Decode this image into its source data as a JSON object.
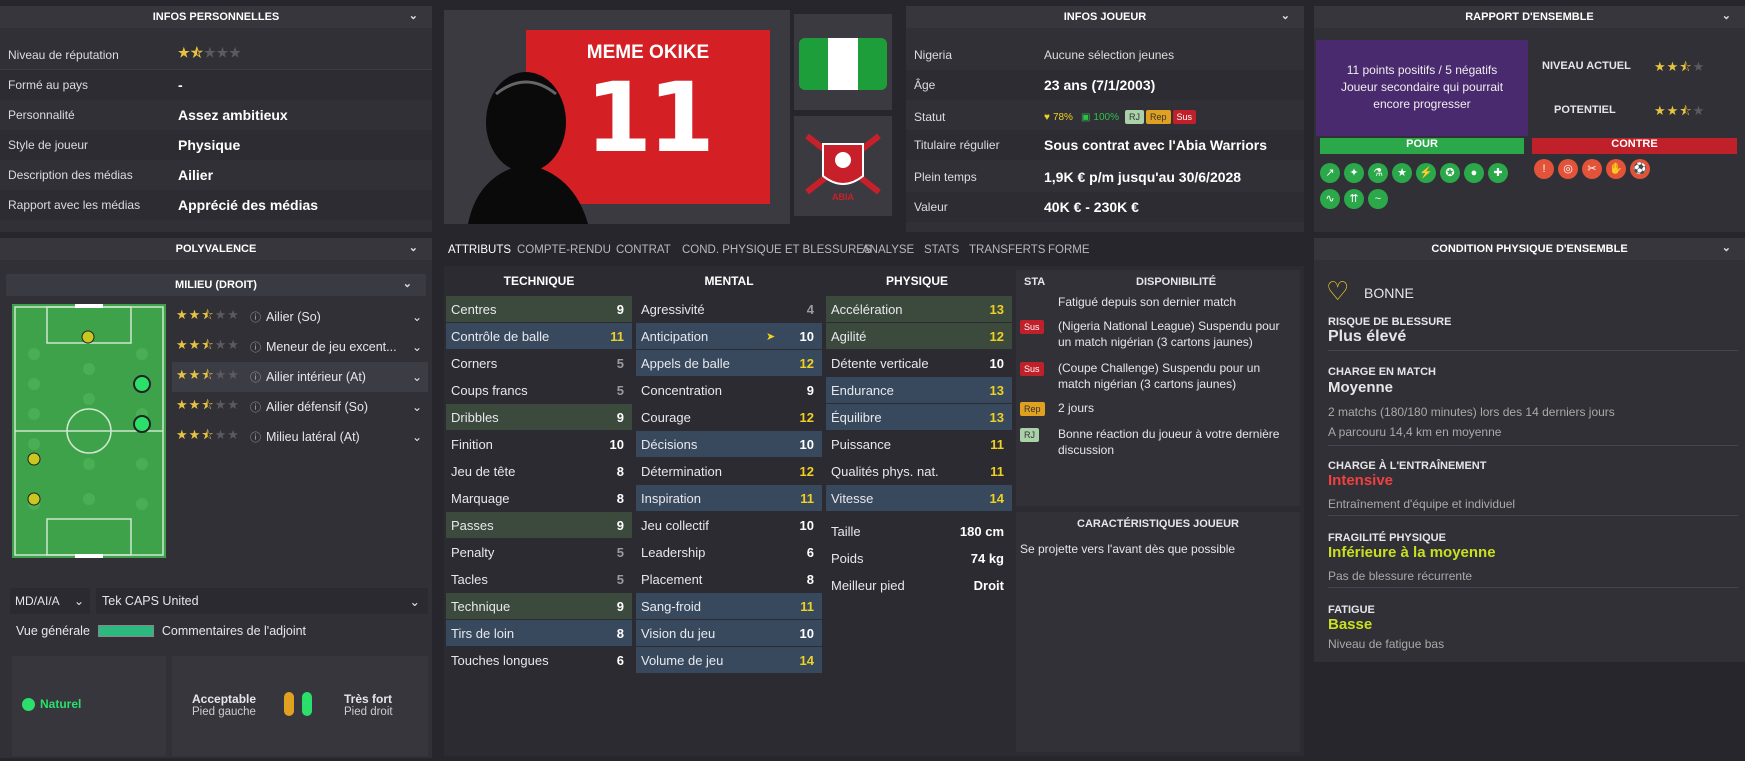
{
  "personal": {
    "title": "INFOS PERSONNELLES",
    "rows": [
      {
        "label": "Niveau de réputation",
        "value": ""
      },
      {
        "label": "Formé au pays",
        "value": "-"
      },
      {
        "label": "Personnalité",
        "value": "Assez ambitieux"
      },
      {
        "label": "Style de joueur",
        "value": "Physique"
      },
      {
        "label": "Description des médias",
        "value": "Ailier"
      },
      {
        "label": "Rapport avec les médias",
        "value": "Apprécié des médias"
      }
    ],
    "reputation_stars": 1.5
  },
  "player": {
    "name": "MEME OKIKE",
    "number": "11",
    "club_logo_text": "ABIA WARRIORS FC"
  },
  "info": {
    "title": "INFOS JOUEUR",
    "rows": [
      {
        "label": "Nigeria",
        "value": "Aucune sélection jeunes"
      },
      {
        "label": "Âge",
        "value": "23 ans (7/1/2003)"
      },
      {
        "label": "Statut",
        "value": ""
      },
      {
        "label": "Titulaire régulier",
        "value": "Sous contrat avec l'Abia Warriors"
      },
      {
        "label": "Plein temps",
        "value": "1,9K € p/m jusqu'au 30/6/2028"
      },
      {
        "label": "Valeur",
        "value": "40K € - 230K €"
      }
    ],
    "status": {
      "morale": "78%",
      "fitness": "100%",
      "badges": [
        "RJ",
        "Rep",
        "Sus"
      ]
    }
  },
  "report": {
    "title": "RAPPORT D'ENSEMBLE",
    "summary1": "11 points positifs / 5 négatifs",
    "summary2": "Joueur secondaire qui pourrait encore progresser",
    "current_label": "NIVEAU ACTUEL",
    "potential_label": "POTENTIEL",
    "current_stars": 2.5,
    "potential_stars": 2.5,
    "pour": "POUR",
    "contre": "CONTRE"
  },
  "poly": {
    "title": "POLYVALENCE",
    "position": "MILIEU (DROIT)",
    "roles": [
      {
        "name": "Ailier (So)",
        "stars": 2.5
      },
      {
        "name": "Meneur de jeu excent...",
        "stars": 2.5
      },
      {
        "name": "Ailier intérieur (At)",
        "stars": 2.5
      },
      {
        "name": "Ailier défensif (So)",
        "stars": 2.5
      },
      {
        "name": "Milieu latéral (At)",
        "stars": 2.5
      }
    ],
    "formation": "MD/AI/A",
    "team": "Tek CAPS United",
    "overview": "Vue générale",
    "assistant": "Commentaires de l'adjoint",
    "natural": "Naturel",
    "left_foot_val": "Acceptable",
    "left_foot": "Pied gauche",
    "right_foot_val": "Très fort",
    "right_foot": "Pied droit"
  },
  "tabs": [
    "ATTRIBUTS",
    "COMPTE-RENDU",
    "CONTRAT",
    "COND. PHYSIQUE ET BLESSURES",
    "ANALYSE",
    "STATS",
    "TRANSFERTS",
    "FORME"
  ],
  "attrs": {
    "tech_title": "TECHNIQUE",
    "mental_title": "MENTAL",
    "phys_title": "PHYSIQUE",
    "technique": [
      [
        "Centres",
        "9"
      ],
      [
        "Contrôle de balle",
        "11"
      ],
      [
        "Corners",
        "5"
      ],
      [
        "Coups francs",
        "5"
      ],
      [
        "Dribbles",
        "9"
      ],
      [
        "Finition",
        "10"
      ],
      [
        "Jeu de tête",
        "8"
      ],
      [
        "Marquage",
        "8"
      ],
      [
        "Passes",
        "9"
      ],
      [
        "Penalty",
        "5"
      ],
      [
        "Tacles",
        "5"
      ],
      [
        "Technique",
        "9"
      ],
      [
        "Tirs de loin",
        "8"
      ],
      [
        "Touches longues",
        "6"
      ]
    ],
    "mental": [
      [
        "Agressivité",
        "4"
      ],
      [
        "Anticipation",
        "10"
      ],
      [
        "Appels de balle",
        "12"
      ],
      [
        "Concentration",
        "9"
      ],
      [
        "Courage",
        "12"
      ],
      [
        "Décisions",
        "10"
      ],
      [
        "Détermination",
        "12"
      ],
      [
        "Inspiration",
        "11"
      ],
      [
        "Jeu collectif",
        "10"
      ],
      [
        "Leadership",
        "6"
      ],
      [
        "Placement",
        "8"
      ],
      [
        "Sang-froid",
        "11"
      ],
      [
        "Vision du jeu",
        "10"
      ],
      [
        "Volume de jeu",
        "14"
      ]
    ],
    "physique": [
      [
        "Accélération",
        "13"
      ],
      [
        "Agilité",
        "12"
      ],
      [
        "Détente verticale",
        "10"
      ],
      [
        "Endurance",
        "13"
      ],
      [
        "Équilibre",
        "13"
      ],
      [
        "Puissance",
        "11"
      ],
      [
        "Qualités phys. nat.",
        "11"
      ],
      [
        "Vitesse",
        "14"
      ]
    ],
    "body": [
      [
        "Taille",
        "180 cm"
      ],
      [
        "Poids",
        "74 kg"
      ],
      [
        "Meilleur pied",
        "Droit"
      ]
    ]
  },
  "dispo": {
    "sta": "STA",
    "title": "DISPONIBILITÉ",
    "items": [
      {
        "badge": "",
        "text": "Fatigué depuis son dernier match"
      },
      {
        "badge": "Sus",
        "text": "(Nigeria National League) Suspendu pour un match nigérian (3 cartons jaunes)"
      },
      {
        "badge": "Sus",
        "text": "(Coupe Challenge) Suspendu pour un match nigérian (3 cartons jaunes)"
      },
      {
        "badge": "Rep",
        "text": "2 jours"
      },
      {
        "badge": "RJ",
        "text": "Bonne réaction du joueur à votre dernière discussion"
      }
    ]
  },
  "carac": {
    "title": "CARACTÉRISTIQUES JOUEUR",
    "text": "Se projette vers l'avant dès que possible"
  },
  "condition": {
    "title": "CONDITION PHYSIQUE D'ENSEMBLE",
    "state": "BONNE",
    "risk_label": "RISQUE DE BLESSURE",
    "risk": "Plus élevé",
    "match_label": "CHARGE EN MATCH",
    "match": "Moyenne",
    "match_sub1": "2 matchs (180/180 minutes) lors des 14 derniers jours",
    "match_sub2": "A parcouru 14,4 km en moyenne",
    "train_label": "CHARGE À L'ENTRAÎNEMENT",
    "train": "Intensive",
    "train_sub": "Entraînement d'équipe et individuel",
    "frag_label": "FRAGILITÉ PHYSIQUE",
    "frag": "Inférieure à la moyenne",
    "frag_sub": "Pas de blessure récurrente",
    "fat_label": "FATIGUE",
    "fat": "Basse",
    "fat_sub": "Niveau de fatigue bas"
  },
  "colors": {
    "green": "#2aa84a",
    "red": "#c0202a",
    "yellow": "#f0d020",
    "purple": "#4a2a6e"
  }
}
